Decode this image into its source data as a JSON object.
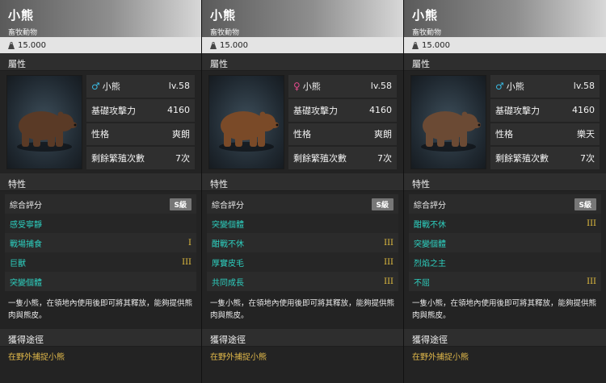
{
  "cards": [
    {
      "title": "小熊",
      "category": "畜牧動物",
      "price": "15.000",
      "section_attr": "屬性",
      "gender": "male",
      "gender_symbol": "♂",
      "name": "小熊",
      "level": "lv.58",
      "attack_label": "基礎攻擊力",
      "attack_value": "4160",
      "personality_label": "性格",
      "personality_value": "爽朗",
      "breed_label": "剩餘繁殖次數",
      "breed_value": "7次",
      "section_traits": "特性",
      "rating_label": "綜合評分",
      "rating_value": "S級",
      "traits": [
        {
          "name": "感受寧靜",
          "level": ""
        },
        {
          "name": "戰場捕食",
          "level": "I"
        },
        {
          "name": "巨獸",
          "level": "III"
        },
        {
          "name": "突變個體",
          "level": ""
        }
      ],
      "description": "一隻小熊，在領地內使用後即可將其釋放，能夠提供熊肉與熊皮。",
      "section_obtain": "獲得途徑",
      "obtain": "在野外捕捉小熊",
      "fur_color": "#5a3a26"
    },
    {
      "title": "小熊",
      "category": "畜牧動物",
      "price": "15.000",
      "section_attr": "屬性",
      "gender": "female",
      "gender_symbol": "♀",
      "name": "小熊",
      "level": "lv.58",
      "attack_label": "基礎攻擊力",
      "attack_value": "4160",
      "personality_label": "性格",
      "personality_value": "爽朗",
      "breed_label": "剩餘繁殖次數",
      "breed_value": "7次",
      "section_traits": "特性",
      "rating_label": "綜合評分",
      "rating_value": "S級",
      "traits": [
        {
          "name": "突變個體",
          "level": ""
        },
        {
          "name": "酣戰不休",
          "level": "III"
        },
        {
          "name": "厚實皮毛",
          "level": "III"
        },
        {
          "name": "共同成長",
          "level": "III"
        }
      ],
      "description": "一隻小熊，在領地內使用後即可將其釋放，能夠提供熊肉與熊皮。",
      "section_obtain": "獲得途徑",
      "obtain": "在野外捕捉小熊",
      "fur_color": "#7a4a28"
    },
    {
      "title": "小熊",
      "category": "畜牧動物",
      "price": "15.000",
      "section_attr": "屬性",
      "gender": "male",
      "gender_symbol": "♂",
      "name": "小熊",
      "level": "lv.58",
      "attack_label": "基礎攻擊力",
      "attack_value": "4160",
      "personality_label": "性格",
      "personality_value": "樂天",
      "breed_label": "剩餘繁殖次數",
      "breed_value": "7次",
      "section_traits": "特性",
      "rating_label": "綜合評分",
      "rating_value": "S級",
      "traits": [
        {
          "name": "酣戰不休",
          "level": "III"
        },
        {
          "name": "突變個體",
          "level": ""
        },
        {
          "name": "烈焰之主",
          "level": ""
        },
        {
          "name": "不屈",
          "level": "III"
        }
      ],
      "description": "一隻小熊，在領地內使用後即可將其釋放，能夠提供熊肉與熊皮。",
      "section_obtain": "獲得途徑",
      "obtain": "在野外捕捉小熊",
      "fur_color": "#6b4a34"
    }
  ]
}
